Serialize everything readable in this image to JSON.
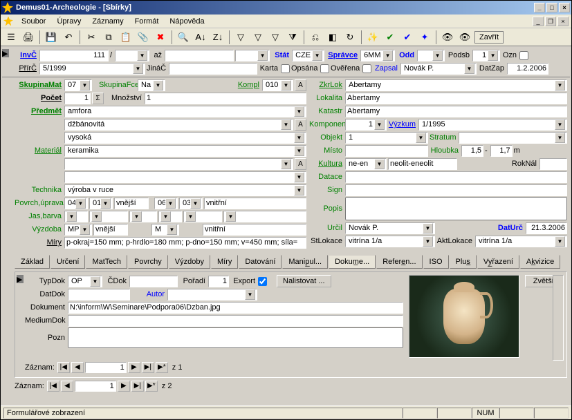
{
  "title": "Demus01-Archeologie - [Sbírky]",
  "menu": {
    "soubor": "Soubor",
    "upravy": "Úpravy",
    "zaznamy": "Záznamy",
    "format": "Formát",
    "napoveda": "Nápověda"
  },
  "toolbar_close": "Zavřít",
  "header": {
    "invc": "InvČ",
    "invc_val": "111",
    "invc_sep": "/",
    "az": "až",
    "stat": "Stát",
    "stat_val": "CZE",
    "spravce": "Správce",
    "spravce_val": "6MM",
    "odd": "Odd",
    "podsb": "Podsb",
    "podsb_val": "1",
    "ozn": "Ozn",
    "prirc": "PřírČ",
    "prirc_val": "5/1999",
    "jinac": "JináČ",
    "karta": "Karta",
    "opsana": "Opsána",
    "overena": "Ověřena",
    "zapsal": "Zapsal",
    "zapsal_val": "Novák P.",
    "datzap": "DatZap",
    "datzap_val": "1.2.2006"
  },
  "left": {
    "skupinamat": "SkupinaMat",
    "skupinamat_val": "07",
    "skupinafce": "SkupinaFce",
    "skupinafce_val": "Na",
    "kompl": "Kompl",
    "kompl_val": "010",
    "pocet": "Počet",
    "pocet_val": "1",
    "mnozstvi": "Množství",
    "mnozstvi_val": "1",
    "predmet": "Předmět",
    "predmet_val": "amfora",
    "predmet_sub1": "džbánovitá",
    "predmet_sub2": "vysoká",
    "material": "Materiál",
    "material_val": "keramika",
    "technika": "Technika",
    "technika_val": "výroba v ruce",
    "povrchuprava": "Povrch,úprava",
    "povrch_v1": "04",
    "povrch_v2": "01",
    "vnejsi": "vnější",
    "povrch_v3": "06",
    "povrch_v4": "03",
    "vnitrni": "vnitřní",
    "jasbarva": "Jas,barva",
    "vyzdoba": "Výzdoba",
    "vyzdoba_v1": "MP",
    "vyzdoba_m": "M",
    "miry": "Míry",
    "miry_val": "p-okraj=150 mm; p-hrdlo=180 mm; p-dno=150 mm; v=450 mm; síla="
  },
  "right": {
    "zkrlok": "ZkrLok",
    "zkrlok_val": "Abertamy",
    "lokalita": "Lokalita",
    "lokalita_val": "Abertamy",
    "katastr": "Katastr",
    "katastr_val": "Abertamy",
    "komponent": "Komponent",
    "komponent_val": "1",
    "vyzkum": "Výzkum",
    "vyzkum_val": "1/1995",
    "objekt": "Objekt",
    "objekt_val": "1",
    "stratum": "Stratum",
    "misto": "Místo",
    "hloubka": "Hloubka",
    "hloubka_v1": "1,5",
    "hloubka_sep": "-",
    "hloubka_v2": "1,7",
    "hl_unit": "m",
    "kultura": "Kultura",
    "kultura_v1": "ne-en",
    "kultura_v2": "neolit-eneolit",
    "roknal": "RokNál",
    "datace": "Datace",
    "sign": "Sign",
    "popis": "Popis",
    "urcil": "Určil",
    "urcil_val": "Novák P.",
    "daturc": "DatUrč",
    "daturc_val": "21.3.2006",
    "stlokace": "StLokace",
    "stlokace_val": "vitrína 1/a",
    "aktlokace": "AktLokace",
    "aktlokace_val": "vitrína 1/a"
  },
  "tabs": {
    "zaklad": "Základ",
    "urceni": "Určení",
    "mattech": "MatTech",
    "povrchy": "Povrchy",
    "vyzdoby": "Výzdoby",
    "miry": "Míry",
    "datovani": "Datování",
    "manipul": "Manip̲ul...",
    "dokume": "Dokum̲e...",
    "referen": "Refere̲n...",
    "iso": "ISO",
    "plus": "Plus̲",
    "vyrazeni": "Vy̲řazení",
    "akvizice": "Ak̲vizice"
  },
  "dok": {
    "typdok": "TypDok",
    "typdok_val": "OP",
    "cdok": "ČDok",
    "poradi": "Pořadí",
    "poradi_val": "1",
    "export": "Export",
    "nalistovat": "Nalistovat ...",
    "zvetsit": "Zvětšit",
    "datdok": "DatDok",
    "autor": "Autor",
    "dokument": "Dokument",
    "dokument_val": "N:\\inform\\W\\Seminare\\Podpora06\\Dzban.jpg",
    "mediumdok": "MediumDok",
    "pozn": "Pozn"
  },
  "nav": {
    "zaznam": "Záznam:",
    "rec1": "1",
    "of1": "z  1",
    "rec2": "1",
    "of2": "z  2"
  },
  "status": {
    "text": "Formulářové zobrazení",
    "num": "NUM"
  }
}
